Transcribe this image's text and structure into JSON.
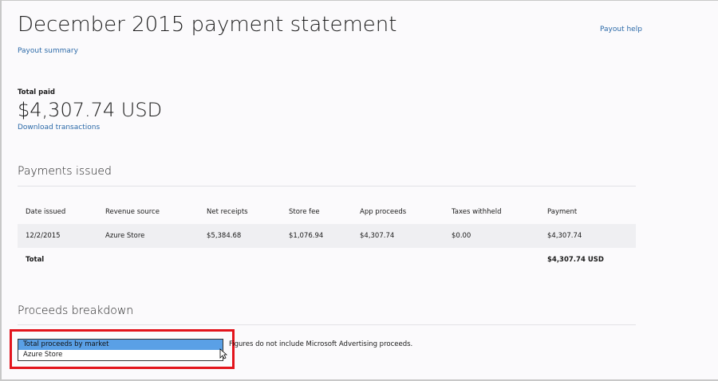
{
  "header": {
    "title": "December 2015 payment statement",
    "payout_summary": "Payout summary",
    "payout_help": "Payout help"
  },
  "total": {
    "label": "Total paid",
    "amount": "$4,307.74 USD",
    "download": "Download transactions"
  },
  "payments": {
    "title": "Payments issued",
    "columns": [
      "Date issued",
      "Revenue source",
      "Net receipts",
      "Store fee",
      "App proceeds",
      "Taxes withheld",
      "Payment"
    ],
    "rows": [
      [
        "12/2/2015",
        "Azure Store",
        "$5,384.68",
        "$1,076.94",
        "$4,307.74",
        "$0.00",
        "$4,307.74"
      ]
    ],
    "total_label": "Total",
    "total_value": "$4,307.74 USD"
  },
  "proceeds": {
    "title": "Proceeds breakdown",
    "options": [
      "Total proceeds by market",
      "Azure Store"
    ],
    "selected": "Total proceeds by market",
    "note": "Figures do not include Microsoft Advertising proceeds."
  },
  "colors": {
    "link": "#2c6aa8",
    "highlight": "#e3141c",
    "selected": "#5aa0e6"
  }
}
